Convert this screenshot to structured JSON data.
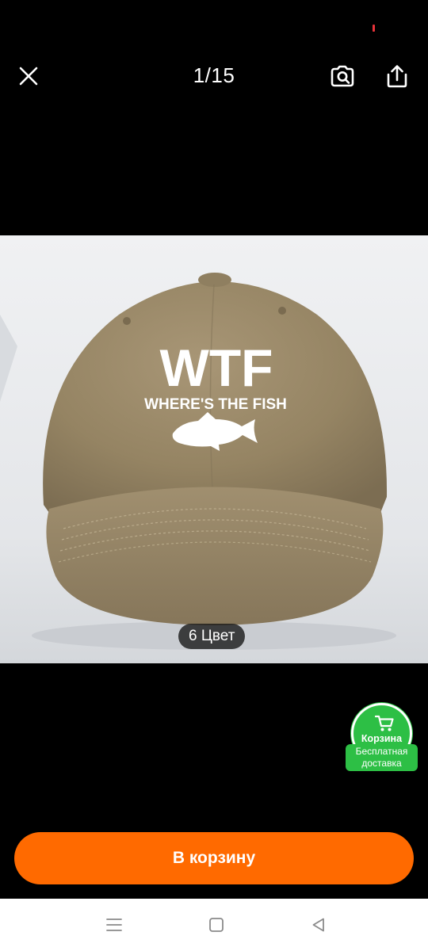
{
  "viewer": {
    "counter": "1/15",
    "close_icon": "close-icon",
    "lens_icon": "visual-search-icon",
    "share_icon": "share-icon"
  },
  "product_image": {
    "print_main": "WTF",
    "print_sub": "WHERE'S THE FISH",
    "cap_color": "#9b8a6a",
    "background_color": "#e9eaec"
  },
  "color_pill": {
    "label": "6 Цвет"
  },
  "cart_badge": {
    "label": "Корзина",
    "ribbon_line1": "Бесплатная",
    "ribbon_line2": "доставка",
    "color": "#2dbf45",
    "icon": "cart-icon"
  },
  "add_to_cart": {
    "label": "В корзину",
    "color": "#ff6a00"
  },
  "system_nav": {
    "menu_icon": "menu-icon",
    "home_icon": "home-icon",
    "back_icon": "back-icon"
  }
}
